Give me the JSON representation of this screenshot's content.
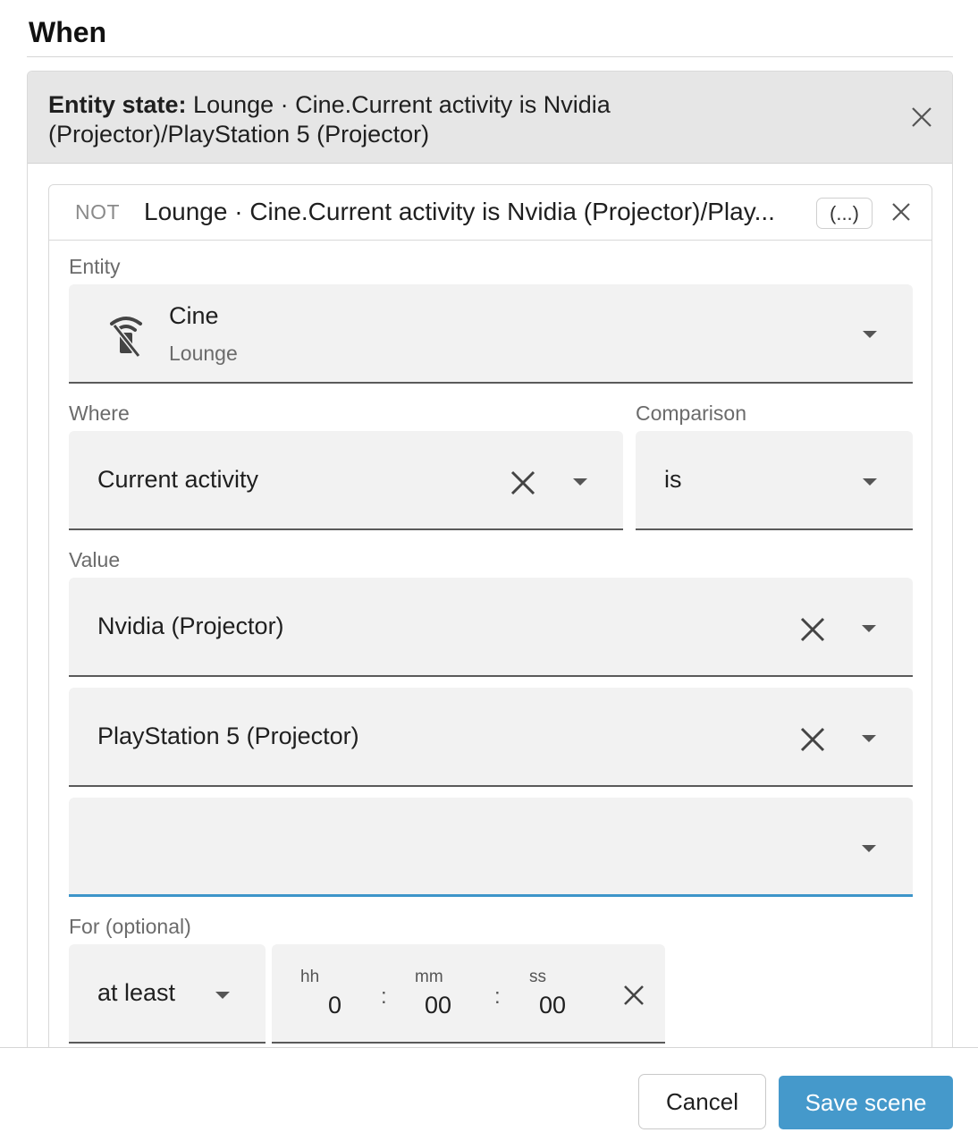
{
  "section": {
    "title": "When"
  },
  "condition": {
    "type_label": "Entity state:",
    "summary": "Lounge · Cine.Current activity is Nvidia (Projector)/PlayStation 5 (Projector)",
    "inner": {
      "negation": "NOT",
      "summary": "Lounge · Cine.Current activity is Nvidia (Projector)/Play...",
      "more_button": "(...)"
    }
  },
  "entity": {
    "label": "Entity",
    "name": "Cine",
    "area": "Lounge",
    "icon": "remote-off-icon"
  },
  "where": {
    "label": "Where",
    "value": "Current activity"
  },
  "comparison": {
    "label": "Comparison",
    "value": "is"
  },
  "value": {
    "label": "Value",
    "items": [
      "Nvidia (Projector)",
      "PlayStation 5 (Projector)"
    ],
    "new_item": ""
  },
  "duration": {
    "label": "For (optional)",
    "mode": "at least",
    "hh_label": "hh",
    "mm_label": "mm",
    "ss_label": "ss",
    "hh": "0",
    "mm": "00",
    "ss": "00",
    "separator": ":"
  },
  "footer": {
    "cancel": "Cancel",
    "save": "Save scene"
  },
  "colors": {
    "accent": "#4599cb",
    "active_underline": "#3d95c9",
    "header_bg": "#e6e6e6",
    "field_bg": "#f2f2f2"
  }
}
